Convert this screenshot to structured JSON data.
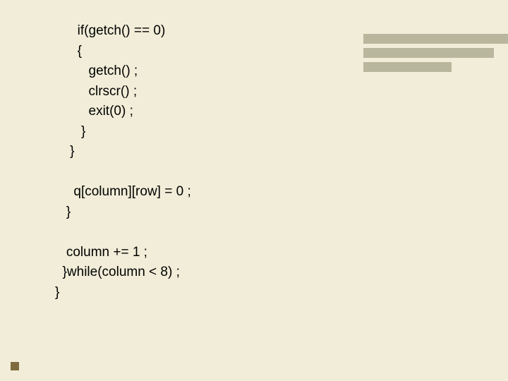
{
  "code": {
    "l1": "      if(getch() == 0)",
    "l2": "      {",
    "l3": "         getch() ;",
    "l4": "         clrscr() ;",
    "l5": "         exit(0) ;",
    "l6": "       }",
    "l7": "    }",
    "l8": "",
    "l9": "     q[column][row] = 0 ;",
    "l10": "   }",
    "l11": "",
    "l12": "   column += 1 ;",
    "l13": "  }while(column < 8) ;",
    "l14": "}"
  }
}
